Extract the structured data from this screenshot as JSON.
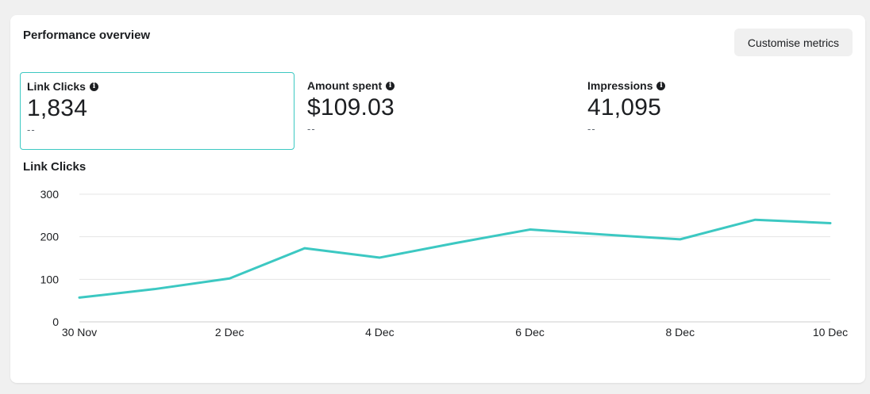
{
  "card": {
    "title": "Performance overview",
    "customise_label": "Customise metrics"
  },
  "metrics": [
    {
      "label": "Link Clicks",
      "value": "1,834",
      "change": "--",
      "selected": true
    },
    {
      "label": "Amount spent",
      "value": "$109.03",
      "change": "--",
      "selected": false
    },
    {
      "label": "Impressions",
      "value": "41,095",
      "change": "--",
      "selected": false
    }
  ],
  "chart_title": "Link Clicks",
  "chart_data": {
    "type": "line",
    "title": "Link Clicks",
    "x": [
      "30 Nov",
      "1 Dec",
      "2 Dec",
      "3 Dec",
      "4 Dec",
      "5 Dec",
      "6 Dec",
      "7 Dec",
      "8 Dec",
      "9 Dec",
      "10 Dec"
    ],
    "xticks": [
      "30 Nov",
      "2 Dec",
      "4 Dec",
      "6 Dec",
      "8 Dec",
      "10 Dec"
    ],
    "series": [
      {
        "values": [
          57,
          77,
          102,
          173,
          151,
          185,
          217,
          205,
          194,
          240,
          232
        ]
      }
    ],
    "yticks": [
      0,
      100,
      200,
      300
    ],
    "ylim": [
      0,
      300
    ],
    "grid": true,
    "color": "#3cc8c2"
  }
}
